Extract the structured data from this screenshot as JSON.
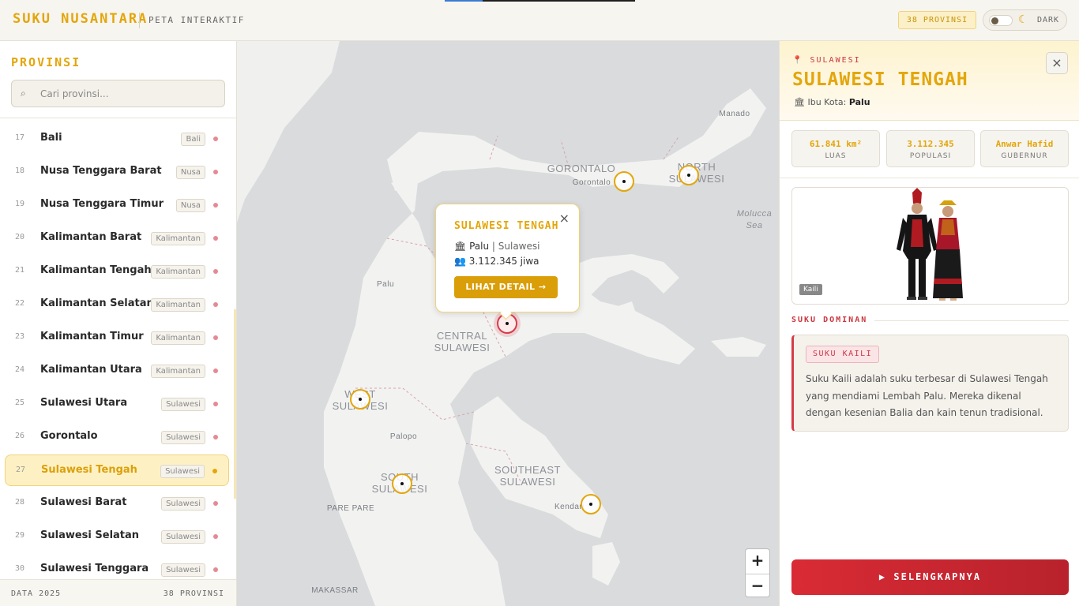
{
  "header": {
    "brand": "SUKU NUSANTARA",
    "subtitle": "PETA INTERAKTIF",
    "province_badge": "38 PROVINSI",
    "dark_label": "DARK",
    "dark_mode": false
  },
  "sidebar": {
    "title": "PROVINSI",
    "search_placeholder": "Cari provinsi...",
    "items": [
      {
        "num": "17",
        "name": "Bali",
        "tag": "Bali",
        "active": false
      },
      {
        "num": "18",
        "name": "Nusa Tenggara Barat",
        "tag": "Nusa",
        "active": false
      },
      {
        "num": "19",
        "name": "Nusa Tenggara Timur",
        "tag": "Nusa",
        "active": false
      },
      {
        "num": "20",
        "name": "Kalimantan Barat",
        "tag": "Kalimantan",
        "active": false
      },
      {
        "num": "21",
        "name": "Kalimantan Tengah",
        "tag": "Kalimantan",
        "active": false
      },
      {
        "num": "22",
        "name": "Kalimantan Selatan",
        "tag": "Kalimantan",
        "active": false
      },
      {
        "num": "23",
        "name": "Kalimantan Timur",
        "tag": "Kalimantan",
        "active": false
      },
      {
        "num": "24",
        "name": "Kalimantan Utara",
        "tag": "Kalimantan",
        "active": false
      },
      {
        "num": "25",
        "name": "Sulawesi Utara",
        "tag": "Sulawesi",
        "active": false
      },
      {
        "num": "26",
        "name": "Gorontalo",
        "tag": "Sulawesi",
        "active": false
      },
      {
        "num": "27",
        "name": "Sulawesi Tengah",
        "tag": "Sulawesi",
        "active": true
      },
      {
        "num": "28",
        "name": "Sulawesi Barat",
        "tag": "Sulawesi",
        "active": false
      },
      {
        "num": "29",
        "name": "Sulawesi Selatan",
        "tag": "Sulawesi",
        "active": false
      },
      {
        "num": "30",
        "name": "Sulawesi Tenggara",
        "tag": "Sulawesi",
        "active": false
      }
    ],
    "footer_left": "DATA 2025",
    "footer_right": "38 PROVINSI"
  },
  "map": {
    "labels": {
      "gorontalo_region": "GORONTALO",
      "gorontalo_city": "Gorontalo",
      "north_sulawesi": "NORTH SULAWESI",
      "manado": "Manado",
      "molucca_sea": "Molucca Sea",
      "palu": "Palu",
      "central_sulawesi": "CENTRAL SULAWESI",
      "west_sulawesi": "WEST SULAWESI",
      "palopo": "Palopo",
      "south_sulawesi": "SOUTH SULAWESI",
      "pare_pare": "PARE PARE",
      "southeast_sulawesi": "SOUTHEAST SULAWESI",
      "kendari": "Kendari",
      "makassar": "MAKASSAR"
    },
    "popup": {
      "title": "SULAWESI TENGAH",
      "capital": "Palu",
      "separator": "|",
      "region": "Sulawesi",
      "population": "3.112.345 jiwa",
      "button": "LIHAT DETAIL →",
      "close": "×"
    },
    "zoom_in": "+",
    "zoom_out": "−"
  },
  "panel": {
    "region_tag": "SULAWESI",
    "title": "SULAWESI TENGAH",
    "capital_label": "Ibu Kota:",
    "capital": "Palu",
    "close": "×",
    "stats": [
      {
        "value": "61.841 km²",
        "label": "LUAS"
      },
      {
        "value": "3.112.345",
        "label": "POPULASI"
      },
      {
        "value": "Anwar Hafid",
        "label": "GUBERNUR"
      }
    ],
    "figure_tag": "Kaili",
    "section_title": "SUKU DOMINAN",
    "suku_badge": "SUKU KAILI",
    "suku_desc": "Suku Kaili adalah suku terbesar di Sulawesi Tengah yang mendiami Lembah Palu. Mereka dikenal dengan kesenian Balia dan kain tenun tradisional.",
    "cta": "SELENGKAPNYA"
  },
  "colors": {
    "accent": "#e3a60b",
    "brand_red": "#d63a48",
    "map_water": "#d9dbdd",
    "map_land": "#f2f2f1"
  }
}
